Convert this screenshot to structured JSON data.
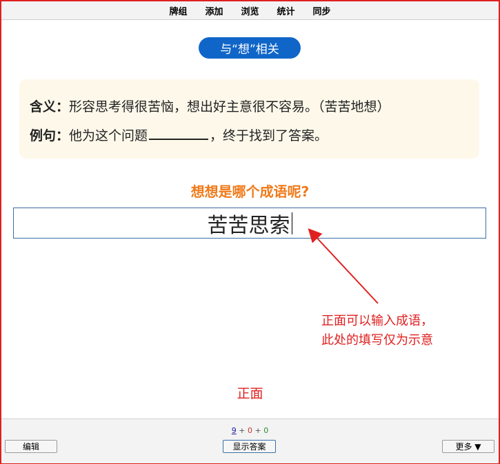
{
  "menu": {
    "decks": "牌组",
    "add": "添加",
    "browse": "浏览",
    "stats": "统计",
    "sync": "同步"
  },
  "card": {
    "tag": "与“想”相关",
    "meaning_label": "含义：",
    "meaning_text": "形容思考得很苦恼，想出好主意很不容易。（苦苦地想）",
    "example_label": "例句：",
    "example_before": "他为这个问题",
    "example_after": "，终于找到了答案。",
    "question": "想想是哪个成语呢?",
    "answer_input": "苦苦思索"
  },
  "annotation": {
    "line1": "正面可以输入成语，",
    "line2": "此处的填写仅为示意",
    "front_label": "正面"
  },
  "bottom": {
    "count_new": "9",
    "count_learn": "0",
    "count_review": "0",
    "plus": "+",
    "edit_label": "编辑",
    "show_answer_label": "显示答案",
    "more_label": "更多 ▼"
  },
  "colors": {
    "frame": "#e02020",
    "pill": "#1066c8",
    "question": "#f07a1a",
    "annotation": "#e02020"
  }
}
